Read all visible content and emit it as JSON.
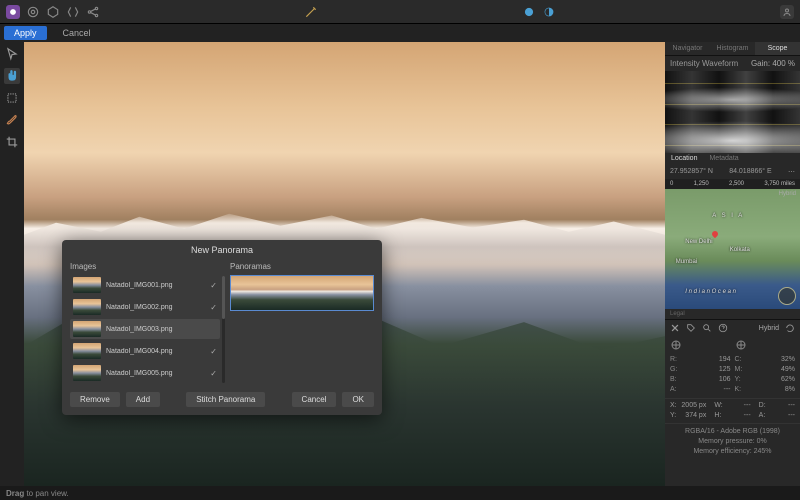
{
  "toolbar": {
    "apply_label": "Apply",
    "cancel_label": "Cancel"
  },
  "panels": {
    "tabs": [
      "Navigator",
      "Histogram",
      "Scope"
    ],
    "active_tab": 2,
    "scope": {
      "title": "Intensity Waveform",
      "gain_label": "Gain:",
      "gain_value": "400 %"
    },
    "sub_tabs": [
      "Location",
      "Metadata"
    ],
    "active_sub_tab": 0,
    "location": {
      "lat": "27.952857° N",
      "lon": "84.018866° E",
      "scale": [
        "0",
        "1,250",
        "2,500",
        "3,750 miles"
      ],
      "map_labels": {
        "asia": "A S I A",
        "delhi": "New Delhi",
        "kolkata": "Kolkata",
        "mumbai": "Mumbai",
        "ocean": "I n d i a n   O c e a n"
      },
      "overlay": "Hybrid",
      "legal": "Legal"
    },
    "info": {
      "hybrid": "Hybrid",
      "rgb": {
        "R": "194",
        "G": "125",
        "B": "106",
        "A": "---"
      },
      "cmyk": {
        "C": "32%",
        "M": "49%",
        "Y": "62%",
        "K": "8%"
      },
      "pos": {
        "X": "2005 px",
        "Y": "374 px",
        "W": "---",
        "H": "---",
        "D": "---",
        "A": "---"
      }
    },
    "doc": {
      "profile": "RGBA/16 - Adobe RGB (1998)",
      "mem_pressure": "Memory pressure: 0%",
      "mem_eff": "Memory efficiency: 245%"
    }
  },
  "dialog": {
    "title": "New Panorama",
    "images_label": "Images",
    "panoramas_label": "Panoramas",
    "images": [
      {
        "name": "Natadol_IMG001.png",
        "checked": true,
        "sel": false
      },
      {
        "name": "Natadol_IMG002.png",
        "checked": true,
        "sel": false
      },
      {
        "name": "Natadol_IMG003.png",
        "checked": false,
        "sel": true
      },
      {
        "name": "Natadol_IMG004.png",
        "checked": true,
        "sel": false
      },
      {
        "name": "Natadol_IMG005.png",
        "checked": true,
        "sel": false
      }
    ],
    "btn_remove": "Remove",
    "btn_add": "Add",
    "btn_stitch": "Stitch Panorama",
    "btn_cancel": "Cancel",
    "btn_ok": "OK"
  },
  "status": {
    "hint_strong": "Drag",
    "hint_rest": " to pan view."
  }
}
